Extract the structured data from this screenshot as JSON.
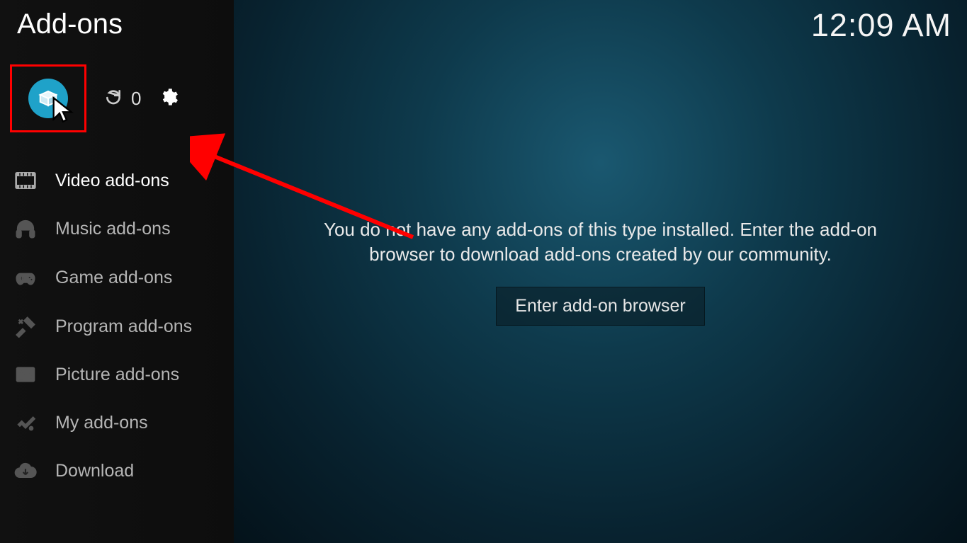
{
  "header": {
    "title": "Add-ons",
    "clock": "12:09 AM"
  },
  "toolbar": {
    "refresh_count": "0"
  },
  "sidebar": {
    "items": [
      {
        "label": "Video add-ons",
        "icon": "film-icon",
        "active": true
      },
      {
        "label": "Music add-ons",
        "icon": "headphones-icon",
        "active": false
      },
      {
        "label": "Game add-ons",
        "icon": "gamepad-icon",
        "active": false
      },
      {
        "label": "Program add-ons",
        "icon": "tools-icon",
        "active": false
      },
      {
        "label": "Picture add-ons",
        "icon": "picture-icon",
        "active": false
      },
      {
        "label": "My add-ons",
        "icon": "sliders-icon",
        "active": false
      },
      {
        "label": "Download",
        "icon": "download-icon",
        "active": false
      }
    ]
  },
  "main": {
    "empty_message": "You do not have any add-ons of this type installed. Enter the add-on browser to download add-ons created by our community.",
    "enter_button": "Enter add-on browser"
  },
  "annotation": {
    "highlight_target": "package-browser-button",
    "highlight_color": "#ff0000"
  }
}
